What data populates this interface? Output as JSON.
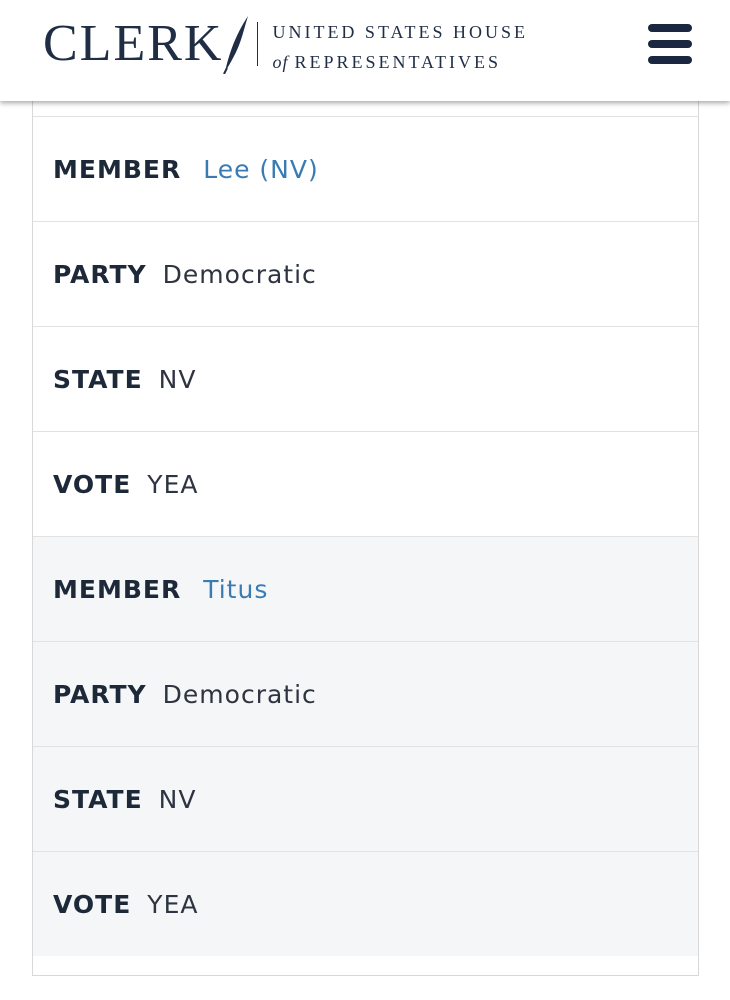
{
  "header": {
    "logo_word": "CLERK",
    "logo_line1": "UNITED STATES HOUSE",
    "logo_of": "of",
    "logo_line2": "REPRESENTATIVES",
    "menu_icon": "hamburger-menu-icon"
  },
  "colors": {
    "navy": "#1f2d45",
    "link": "#3b7bb4",
    "alt_row": "#f5f6f8"
  },
  "members": [
    {
      "member_label": "MEMBER",
      "member": "Lee (NV)",
      "party_label": "PARTY",
      "party": "Democratic",
      "state_label": "STATE",
      "state": "NV",
      "vote_label": "VOTE",
      "vote": "YEA"
    },
    {
      "member_label": "MEMBER",
      "member": "Titus",
      "party_label": "PARTY",
      "party": "Democratic",
      "state_label": "STATE",
      "state": "NV",
      "vote_label": "VOTE",
      "vote": "YEA"
    }
  ]
}
